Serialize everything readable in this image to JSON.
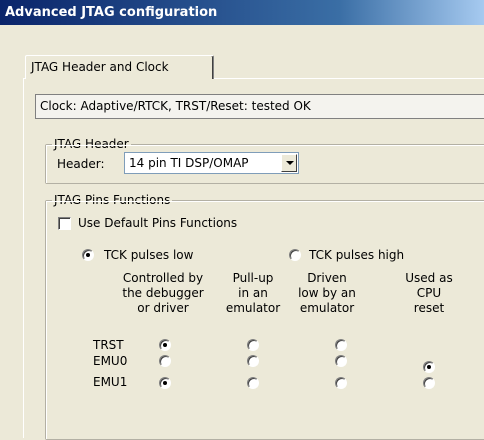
{
  "window": {
    "title": "Advanced JTAG configuration"
  },
  "tabs": [
    {
      "label": "JTAG Header and Clock"
    }
  ],
  "status_text": "Clock: Adaptive/RTCK, TRST/Reset: tested OK",
  "jtag_header": {
    "group_label": "JTAG Header",
    "header_label": "Header:",
    "header_value": "14 pin TI DSP/OMAP"
  },
  "pins": {
    "group_label": "JTAG Pins Functions",
    "use_default_label": "Use Default Pins Functions",
    "use_default_checked": false,
    "tck_low_label": "TCK pulses low",
    "tck_high_label": "TCK pulses high",
    "tck_selected": "low",
    "columns": [
      {
        "line1": "Controlled by",
        "line2": "the debugger",
        "line3": "or driver"
      },
      {
        "line1": "Pull-up",
        "line2": "in an",
        "line3": "emulator"
      },
      {
        "line1": "Driven",
        "line2": "low by an",
        "line3": "emulator"
      },
      {
        "line1": "Used as",
        "line2": "CPU",
        "line3": "reset"
      }
    ],
    "rows": [
      {
        "label": "TRST",
        "selected_column": 0,
        "has_reset_option": false
      },
      {
        "label": "EMU0",
        "selected_column": 3,
        "has_reset_option": true
      },
      {
        "label": "EMU1",
        "selected_column": 0,
        "has_reset_option": true
      }
    ]
  }
}
